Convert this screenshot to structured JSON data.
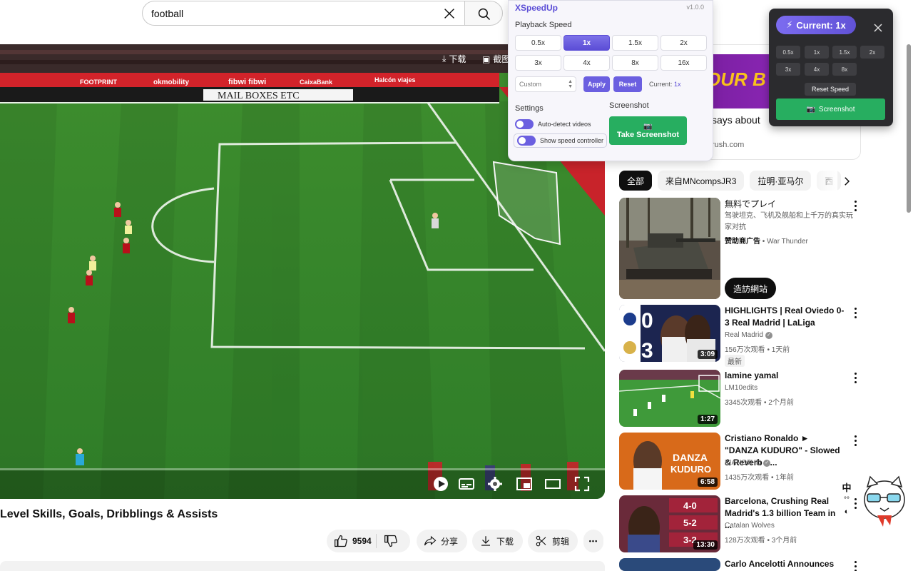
{
  "search": {
    "query": "football"
  },
  "player": {
    "download_label": "下载",
    "screenshot_label": "截图",
    "banners": [
      "MAIL BOXES ETC",
      "fibwi fibwi",
      "CaixaBank",
      "Halcón viajes",
      "okmobility",
      "FOOTPRINT"
    ]
  },
  "video": {
    "title": "Level Skills, Goals, Dribblings & Assists",
    "like_count": "9594",
    "share_label": "分享",
    "download_label": "下载",
    "clip_label": "剪辑",
    "more_label": "•••"
  },
  "ad": {
    "banner_text": "OUR B",
    "says_text": "says about",
    "domain": "rush.com"
  },
  "chips": [
    "全部",
    "来自MNcompsJR3",
    "拉明·亚马尔",
    "西"
  ],
  "sponsored": {
    "title": "無料でプレイ",
    "description": "驾驶坦克、飞机及舰船和上千万的真实玩家对抗",
    "sponsor_label": "赞助商广告",
    "sponsor_name": "War Thunder",
    "cta": "造訪網站"
  },
  "recommendations": [
    {
      "title": "HIGHLIGHTS | Real Oviedo 0-3 Real Madrid | LaLiga",
      "channel": "Real Madrid",
      "verified": true,
      "meta": "156万次观看 • 1天前",
      "badge": "最新",
      "duration": "3:09",
      "score_top": "0",
      "score_bottom": "3"
    },
    {
      "title": "lamine yamal",
      "channel": "LM10edits",
      "verified": false,
      "meta": "3345次观看 • 2个月前",
      "duration": "1:27"
    },
    {
      "title": "Cristiano Ronaldo ► \"DANZA KUDURO\" - Slowed & Reverb • ...",
      "channel": "KIANO7HD",
      "verified": true,
      "meta": "1435万次观看 • 1年前",
      "duration": "6:58",
      "thumb_text": "DANZA KUDURO"
    },
    {
      "title": "Barcelona, Crushing Real Madrid's 1.3 billion Team in ...",
      "channel": "Catalan Wolves",
      "verified": false,
      "meta": "128万次观看 • 3个月前",
      "duration": "13:30",
      "scores": [
        "4-0",
        "5-2",
        "3-2"
      ]
    },
    {
      "title": "Carlo Ancelotti Announces"
    }
  ],
  "ime": {
    "lang": "中",
    "mode1": "°°",
    "mode2": "◐"
  },
  "popup": {
    "title": "XSpeedUp",
    "version": "v1.0.0",
    "playback_label": "Playback Speed",
    "speeds": [
      "0.5x",
      "1x",
      "1.5x",
      "2x",
      "3x",
      "4x",
      "8x",
      "16x"
    ],
    "active_speed": "1x",
    "custom_placeholder": "Custom",
    "apply_label": "Apply",
    "reset_label": "Reset",
    "current_label": "Current:",
    "current_value": "1x",
    "settings_label": "Settings",
    "screenshot_label": "Screenshot",
    "auto_detect_label": "Auto-detect videos",
    "show_controller_label": "Show speed controller",
    "take_screenshot_label": "Take Screenshot"
  },
  "controller": {
    "current_text": "Current: 1x",
    "speeds": [
      "0.5x",
      "1x",
      "1.5x",
      "2x",
      "3x",
      "4x",
      "8x"
    ],
    "reset_label": "Reset Speed",
    "screenshot_label": "Screenshot"
  },
  "colors": {
    "accent": "#5b4dd6",
    "green": "#27ae60",
    "pitch": "#3b8a2e"
  }
}
